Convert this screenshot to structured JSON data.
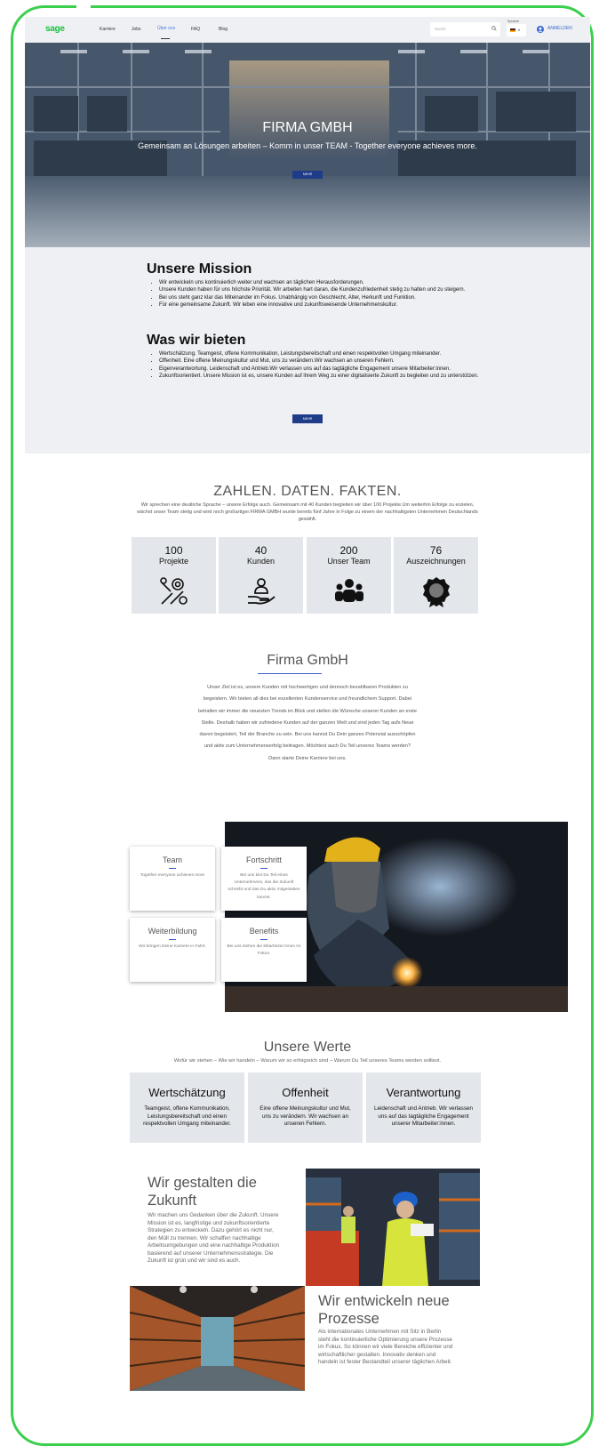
{
  "header": {
    "logo": "sage",
    "nav": [
      "Karriere",
      "Jobs",
      "Über uns",
      "FAQ",
      "Blog"
    ],
    "active_nav": "Über uns",
    "search_placeholder": "Suche",
    "language_label": "Sprache",
    "login_label": "ANMELDEN"
  },
  "hero": {
    "title": "FIRMA GMBH",
    "subtitle": "Gemeinsam an Lösungen arbeiten – Komm in unser TEAM - Together everyone achieves more.",
    "button": "MEHR"
  },
  "mission": {
    "title": "Unsere Mission",
    "items": [
      "Wir entwickeln uns kontinuierlich weiter und wachsen an täglichen Herausforderungen.",
      "Unsere Kunden haben für uns höchste Priorität. Wir arbeiten hart daran, die Kundenzufriedenheit stetig zu halten und zu steigern.",
      "Bei uns steht ganz klar das Miteinander im Fokus. Unabhängig von Geschlecht, Alter, Herkunft und Funktion.",
      "Für eine gemeinsame Zukunft. Wir leben eine innovative und zukunftsweisende Unternehmenskultur."
    ]
  },
  "offer": {
    "title": "Was wir bieten",
    "items": [
      "Wertschätzung. Teamgeist, offene Kommunikation, Leistungsbereitschaft und einen respektvollen Umgang miteinander.",
      "Offenheit. Eine offene Meinungskultur und Mut, uns zu verändern.Wir wachsen an unseren Fehlern.",
      "Eigenverantwortung. Leidenschaft und Antrieb.Wir verlassen uns auf das tagtägliche Engagement unsere Mitarbeiter:innen.",
      "Zukunftsorientiert. Unsere Mission ist es, unsere Kunden auf ihrem Weg zu einer digitalisierte Zukunft zu begleiten und zu unterstützen."
    ],
    "button": "MEHR"
  },
  "facts": {
    "title": "ZAHLEN. DATEN. FAKTEN.",
    "subtitle": "Wir sprechen eine deutliche Sprache – unsere Erfolge auch. Gemeinsam mit 40 Kunden begleiten wir über 100 Projekte.Um weiterhin Erfolge zu erzielen, wächst unser Team stetig und wird noch großartiger.FIRMA GMBH wurde bereits fünf Jahre in Folge zu einem der nachhaltigsten Unternehmen Deutschlands gewählt.",
    "items": [
      {
        "number": "100",
        "label": "Projekte",
        "icon": "tools-icon"
      },
      {
        "number": "40",
        "label": "Kunden",
        "icon": "customer-hand-icon"
      },
      {
        "number": "200",
        "label": "Unser Team",
        "icon": "team-icon"
      },
      {
        "number": "76",
        "label": "Auszeichnungen",
        "icon": "award-icon"
      }
    ]
  },
  "firma": {
    "title": "Firma GmbH",
    "text": "Unser Ziel ist es, unsere Kunden mit hochwertigen und dennoch bezahlbaren Produkten zu begeistern. Wir bieten all dies bei exzellenten Kundenservice und freundlichem Support. Dabei behalten wir immer die neuesten Trends im Blick und stellen die Wünsche unserer Kunden an erste Stelle. Deshalb haben wir zufriedene Kunden auf der ganzen Welt und sind jeden Tag aufs Neue davon begeistert, Teil der Branche zu sein. Bei uns kannst Du Dein ganzes Potenzial ausschöpfen und aktiv zum Unternehmenserfolg beitragen. Möchtest auch Du Teil unseres Teams werden? Dann starte Deine Karriere bei uns."
  },
  "cards": [
    {
      "title": "Team",
      "text": "Together everyone achieves more"
    },
    {
      "title": "Fortschritt",
      "text": "Bei uns bist Du Teil eines Unternehmens, das die Zukunft schreibt und das Du aktiv mitgestalten kannst."
    },
    {
      "title": "Weiterbildung",
      "text": "Wir bringen Deine Karriere in Fahrt."
    },
    {
      "title": "Benefits",
      "text": "Bei uns stehen die Mitarbeiter:innen im Fokus."
    }
  ],
  "werte": {
    "title": "Unsere Werte",
    "subtitle": "Wofür wir stehen – Wie wir handeln – Warum wir so erfolgreich sind – Warum Du Teil unseres Teams werden solltest.",
    "items": [
      {
        "title": "Wertschätzung",
        "text": "Teamgeist, offene Kommunikation, Leistungsbereitschaft und einen respektvollen Umgang miteinander."
      },
      {
        "title": "Offenheit",
        "text": "Eine offene Meinungskultur und Mut, uns zu verändern. Wir wachsen an unseren Fehlern."
      },
      {
        "title": "Verantwortung",
        "text": "Leidenschaft und Antrieb. Wir verlassen uns auf das tagtägliche Engagement unserer Mitarbeiter:innen."
      }
    ]
  },
  "zukunft": {
    "title": "Wir gestalten die Zukunft",
    "text": "Wir machen uns Gedanken über die Zukunft. Unsere Mission ist es, langfristige und zukunftsorientierte Strategien zu entwickeln. Dazu gehört es nicht nur, den Müll zu trennen. Wir schaffen nachhaltige Arbeitsumgebungen und eine nachhaltige Produktion basierend auf unserer Unternehmensstrategie. Die Zukunft ist grün und wir sind es auch."
  },
  "prozesse": {
    "title": "Wir entwickeln neue Prozesse",
    "text": "Als internationales Unternehmen mit Sitz in Berlin steht die kontinuierliche Optimierung unsere Prozesse im Fokus. So können wir viele Bereiche effizienter und wirtschaftlicher gestalten. Innovativ denken und handeln ist fester Bestandteil unserer täglichen Arbeit."
  }
}
